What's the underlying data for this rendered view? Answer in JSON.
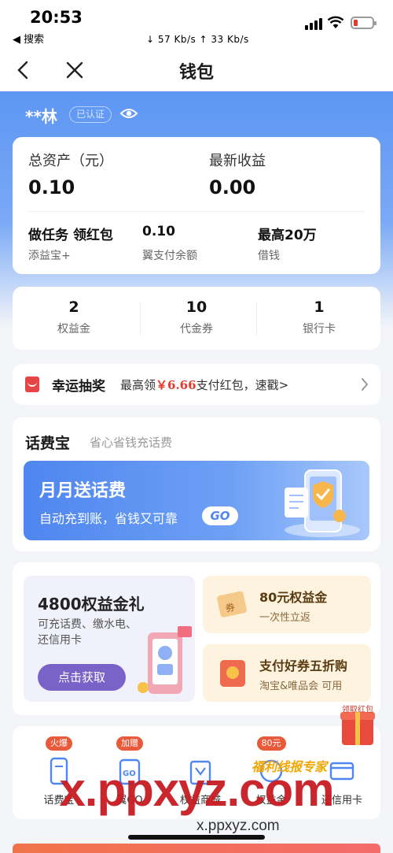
{
  "status_bar": {
    "time": "20:53",
    "back_app": "◀ 搜索",
    "net_speed": "↓ 57 Kb/s   ↑ 33 Kb/s"
  },
  "nav": {
    "title": "钱包",
    "back_icon": "chevron-left-icon",
    "close_icon": "close-icon"
  },
  "user": {
    "name": "**林",
    "verified": "已认证",
    "eye_icon": "eye-icon"
  },
  "assets": {
    "total_label": "总资产（元）",
    "total_value": "0.10",
    "earnings_label": "最新收益",
    "earnings_value": "0.00",
    "items": [
      {
        "title": "做任务 领红包",
        "sub": "添益宝+"
      },
      {
        "title": "0.10",
        "sub": "翼支付余额"
      },
      {
        "title": "最高20万",
        "sub": "借钱"
      }
    ]
  },
  "stats": [
    {
      "value": "2",
      "label": "权益金"
    },
    {
      "value": "10",
      "label": "代金券"
    },
    {
      "value": "1",
      "label": "银行卡"
    }
  ],
  "lottery": {
    "title": "幸运抽奖",
    "desc_prefix": "最高领",
    "amount": "￥6.66",
    "desc_suffix": "支付红包，速戳>"
  },
  "phone_bill": {
    "title": "话费宝",
    "subtitle": "省心省钱充话费",
    "banner_title": "月月送话费",
    "banner_sub": "自动充到账，省钱又可靠",
    "go": "GO"
  },
  "promo": {
    "left_title": "4800权益金礼",
    "left_sub": "可充话费、缴水电、还信用卡",
    "left_button": "点击获取",
    "right": [
      {
        "title": "80元权益金",
        "sub": "一次性立返"
      },
      {
        "title": "支付好券五折购",
        "sub": "淘宝&唯品会 可用"
      }
    ]
  },
  "shortcuts": [
    {
      "tag": "火爆",
      "label": "话费宝"
    },
    {
      "tag": "加赠",
      "label": "翼GO"
    },
    {
      "tag": "",
      "label": "权益商城"
    },
    {
      "tag": "80元",
      "label": "权益金"
    },
    {
      "tag": "",
      "label": "还信用卡"
    }
  ],
  "overlay": {
    "watermark": "x.ppxyz.com",
    "watermark_url": "x.ppxyz.com",
    "brand": "福利线报专家",
    "float_gift": "领取红包"
  },
  "colors": {
    "brand_blue": "#5d96f3",
    "accent_red": "#e63a2e",
    "promo_purple": "#7a63c7"
  }
}
